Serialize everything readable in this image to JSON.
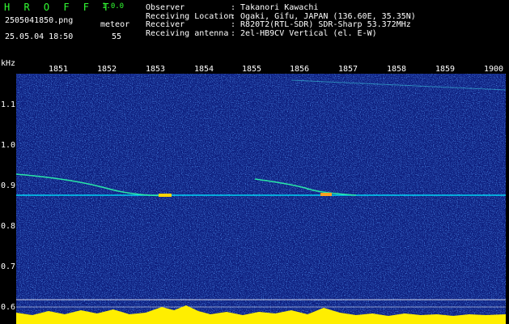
{
  "app": {
    "name": "H R O F F T",
    "version": "1.0.0"
  },
  "file": {
    "name": "2505041850.png",
    "datetime": "25.05.04 18:50"
  },
  "meteor": {
    "label": "meteor",
    "count": "55"
  },
  "info": {
    "labels": "Observer\nReceiving Location\nReceiver\nReceiving antenna",
    "values": ": Takanori Kawachi\n: Ogaki, Gifu, JAPAN (136.60E, 35.35N)\n: R820T2(RTL-SDR) SDR-Sharp 53.372MHz\n: 2el-HB9CV Vertical (el. E-W)"
  },
  "axis": {
    "unit": "kHz",
    "x_ticks": [
      "1851",
      "1852",
      "1853",
      "1854",
      "1855",
      "1856",
      "1857",
      "1858",
      "1859",
      "1900"
    ],
    "y_ticks": [
      "1.1",
      "1.0",
      "0.9",
      "0.8",
      "0.7",
      "0.6"
    ]
  },
  "colors": {
    "background": "#0d1e7e",
    "logo": "#33ff33",
    "trace": "#00e5ff",
    "bars": "#ffee00"
  }
}
